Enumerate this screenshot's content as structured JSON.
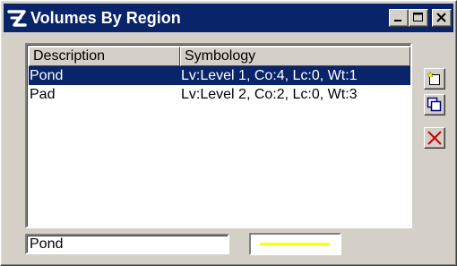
{
  "window": {
    "title": "Volumes By Region",
    "app_icon": "microstation-icon"
  },
  "title_buttons": [
    "minimize-icon",
    "maximize-icon",
    "close-icon"
  ],
  "list": {
    "columns": [
      "Description",
      "Symbology"
    ],
    "rows": [
      {
        "description": "Pond",
        "symbology": "Lv:Level 1, Co:4, Lc:0, Wt:1",
        "selected": true
      },
      {
        "description": "Pad",
        "symbology": "Lv:Level 2, Co:2, Lc:0, Wt:3",
        "selected": false
      }
    ]
  },
  "side_buttons": [
    "add-icon",
    "copy-icon",
    "delete-icon"
  ],
  "form": {
    "name_value": "Pond",
    "symbology_color": "#ffff00"
  },
  "colors": {
    "title_bar": "#0a246a",
    "selection": "#0a246a",
    "face": "#d4d0c8"
  }
}
